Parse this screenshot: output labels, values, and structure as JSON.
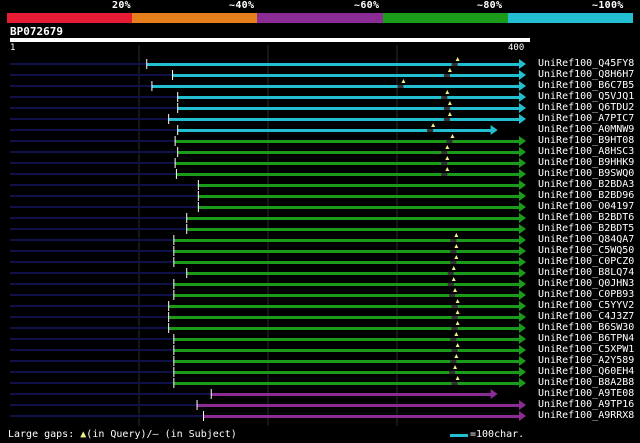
{
  "colors": {
    "scale": [
      "#e81b34",
      "#e57f1b",
      "#8b2b95",
      "#1a9c1a",
      "#21bfcf"
    ],
    "background": "#000000",
    "guide_line": "#2b2b2b",
    "query_line": "#11114a",
    "gap_marker": "#f2f08a",
    "gap_segment": "#333333"
  },
  "legend": {
    "labels": [
      "20%",
      "~40%",
      "~60%",
      "~80%",
      "~100%"
    ]
  },
  "query": {
    "id": "BP072679",
    "ruler_start": "1",
    "ruler_end": "400",
    "length": 400
  },
  "hits": [
    {
      "label": "UniRef100_Q45FY8",
      "color": "cyan",
      "start": 106,
      "end": 400,
      "gaps": [
        347
      ]
    },
    {
      "label": "UniRef100_Q8H6H7",
      "color": "cyan",
      "start": 126,
      "end": 400,
      "gaps": [
        341
      ]
    },
    {
      "label": "UniRef100_B6C7B5",
      "color": "cyan",
      "start": 110,
      "end": 400,
      "gaps": [
        305
      ]
    },
    {
      "label": "UniRef100_Q5VJQ1",
      "color": "cyan",
      "start": 130,
      "end": 400,
      "gaps": [
        339
      ]
    },
    {
      "label": "UniRef100_Q6TDU2",
      "color": "cyan",
      "start": 130,
      "end": 400,
      "gaps": [
        341
      ]
    },
    {
      "label": "UniRef100_A7PIC7",
      "color": "cyan",
      "start": 123,
      "end": 400,
      "gaps": [
        341
      ]
    },
    {
      "label": "UniRef100_A0MNW9",
      "color": "cyan",
      "start": 130,
      "end": 378,
      "gaps": [
        328
      ]
    },
    {
      "label": "UniRef100_B9HT08",
      "color": "green",
      "start": 128,
      "end": 400,
      "gaps": [
        343
      ]
    },
    {
      "label": "UniRef100_A8HSC3",
      "color": "green",
      "start": 130,
      "end": 400,
      "gaps": [
        339
      ]
    },
    {
      "label": "UniRef100_B9HHK9",
      "color": "green",
      "start": 128,
      "end": 400,
      "gaps": [
        339
      ]
    },
    {
      "label": "UniRef100_B9SWQ0",
      "color": "green",
      "start": 129,
      "end": 400,
      "gaps": [
        339
      ]
    },
    {
      "label": "UniRef100_B2BDA3",
      "color": "green",
      "start": 146,
      "end": 400,
      "gaps": []
    },
    {
      "label": "UniRef100_B2BD96",
      "color": "green",
      "start": 146,
      "end": 400,
      "gaps": []
    },
    {
      "label": "UniRef100_O04197",
      "color": "green",
      "start": 146,
      "end": 400,
      "gaps": []
    },
    {
      "label": "UniRef100_B2BDT6",
      "color": "green",
      "start": 137,
      "end": 400,
      "gaps": []
    },
    {
      "label": "UniRef100_B2BDT5",
      "color": "green",
      "start": 137,
      "end": 400,
      "gaps": []
    },
    {
      "label": "UniRef100_Q84QA7",
      "color": "green",
      "start": 127,
      "end": 400,
      "gaps": [
        346
      ]
    },
    {
      "label": "UniRef100_C5WQ50",
      "color": "green",
      "start": 127,
      "end": 400,
      "gaps": [
        346
      ]
    },
    {
      "label": "UniRef100_C0PCZ0",
      "color": "green",
      "start": 127,
      "end": 400,
      "gaps": [
        346
      ]
    },
    {
      "label": "UniRef100_B8LQ74",
      "color": "green",
      "start": 137,
      "end": 400,
      "gaps": [
        344
      ]
    },
    {
      "label": "UniRef100_Q0JHN3",
      "color": "green",
      "start": 127,
      "end": 400,
      "gaps": [
        344
      ]
    },
    {
      "label": "UniRef100_C0PB93",
      "color": "green",
      "start": 127,
      "end": 400,
      "gaps": [
        345
      ]
    },
    {
      "label": "UniRef100_C5YYV2",
      "color": "green",
      "start": 123,
      "end": 400,
      "gaps": [
        347
      ]
    },
    {
      "label": "UniRef100_C4J3Z7",
      "color": "green",
      "start": 123,
      "end": 400,
      "gaps": [
        347
      ]
    },
    {
      "label": "UniRef100_B6SW30",
      "color": "green",
      "start": 123,
      "end": 400,
      "gaps": [
        347
      ]
    },
    {
      "label": "UniRef100_B6TPN4",
      "color": "green",
      "start": 127,
      "end": 400,
      "gaps": [
        346
      ]
    },
    {
      "label": "UniRef100_C5XPW1",
      "color": "green",
      "start": 127,
      "end": 400,
      "gaps": [
        347
      ]
    },
    {
      "label": "UniRef100_A2Y589",
      "color": "green",
      "start": 127,
      "end": 400,
      "gaps": [
        346
      ]
    },
    {
      "label": "UniRef100_Q60EH4",
      "color": "green",
      "start": 127,
      "end": 400,
      "gaps": [
        345
      ]
    },
    {
      "label": "UniRef100_B8A2B8",
      "color": "green",
      "start": 127,
      "end": 400,
      "gaps": [
        347
      ]
    },
    {
      "label": "UniRef100_A9TE08",
      "color": "purple",
      "start": 156,
      "end": 378,
      "gaps": []
    },
    {
      "label": "UniRef100_A9TP16",
      "color": "purple",
      "start": 145,
      "end": 400,
      "gaps": []
    },
    {
      "label": "UniRef100_A9RRX8",
      "color": "purple",
      "start": 150,
      "end": 400,
      "gaps": []
    }
  ],
  "footer": {
    "prefix": "Large gaps:",
    "triangle": "▲",
    "in_query": "(in Query)/",
    "dash": "–",
    "in_subject": " (in Subject)",
    "scale_text": "=100char."
  }
}
